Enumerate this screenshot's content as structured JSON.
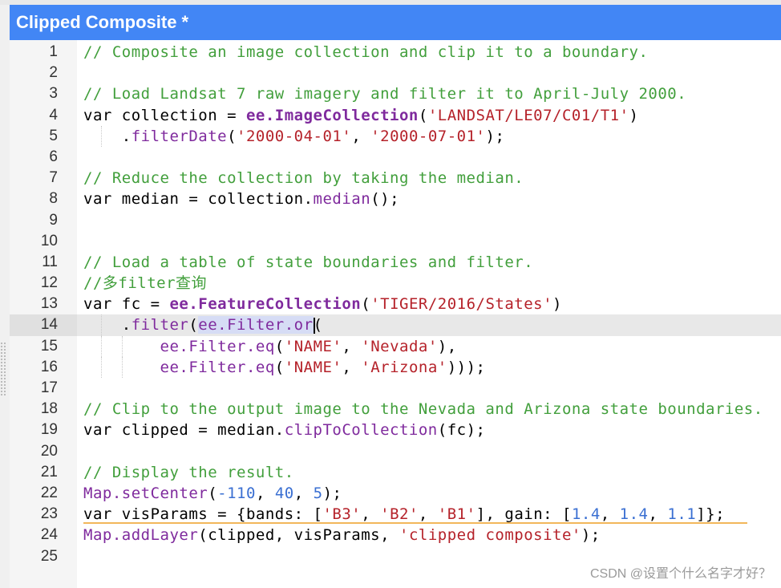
{
  "window": {
    "title": "Clipped Composite *"
  },
  "editor": {
    "active_line": 14,
    "lines": [
      {
        "num": "1",
        "tokens": [
          {
            "t": "c",
            "v": "// Composite an image collection and clip it to a boundary."
          }
        ]
      },
      {
        "num": "2",
        "tokens": []
      },
      {
        "num": "3",
        "tokens": [
          {
            "t": "c",
            "v": "// Load Landsat 7 raw imagery and filter it to April-July 2000."
          }
        ]
      },
      {
        "num": "4",
        "tokens": [
          {
            "t": "k",
            "v": "var collection = "
          },
          {
            "t": "ee",
            "v": "ee.ImageCollection"
          },
          {
            "t": "p",
            "v": "("
          },
          {
            "t": "s",
            "v": "'LANDSAT/LE07/C01/T1'"
          },
          {
            "t": "p",
            "v": ")"
          }
        ]
      },
      {
        "num": "5",
        "tokens": [
          {
            "t": "p",
            "v": "    ."
          },
          {
            "t": "m",
            "v": "filterDate"
          },
          {
            "t": "p",
            "v": "("
          },
          {
            "t": "s",
            "v": "'2000-04-01'"
          },
          {
            "t": "p",
            "v": ", "
          },
          {
            "t": "s",
            "v": "'2000-07-01'"
          },
          {
            "t": "p",
            "v": ");"
          }
        ]
      },
      {
        "num": "6",
        "tokens": []
      },
      {
        "num": "7",
        "tokens": [
          {
            "t": "c",
            "v": "// Reduce the collection by taking the median."
          }
        ]
      },
      {
        "num": "8",
        "tokens": [
          {
            "t": "k",
            "v": "var median = collection."
          },
          {
            "t": "m",
            "v": "median"
          },
          {
            "t": "p",
            "v": "();"
          }
        ]
      },
      {
        "num": "9",
        "tokens": []
      },
      {
        "num": "10",
        "tokens": []
      },
      {
        "num": "11",
        "tokens": [
          {
            "t": "c",
            "v": "// Load a table of state boundaries and filter."
          }
        ]
      },
      {
        "num": "12",
        "tokens": [
          {
            "t": "c",
            "v": "//多filter查询"
          }
        ]
      },
      {
        "num": "13",
        "tokens": [
          {
            "t": "k",
            "v": "var fc = "
          },
          {
            "t": "ee",
            "v": "ee.FeatureCollection"
          },
          {
            "t": "p",
            "v": "("
          },
          {
            "t": "s",
            "v": "'TIGER/2016/States'"
          },
          {
            "t": "p",
            "v": ")"
          }
        ]
      },
      {
        "num": "14",
        "tokens": [
          {
            "t": "p",
            "v": "    ."
          },
          {
            "t": "m",
            "v": "filter"
          },
          {
            "t": "p",
            "v": "("
          },
          {
            "t": "msel",
            "v": "ee.Filter.or"
          },
          {
            "t": "cursor",
            "v": ""
          },
          {
            "t": "p",
            "v": "("
          }
        ]
      },
      {
        "num": "15",
        "tokens": [
          {
            "t": "p",
            "v": "        "
          },
          {
            "t": "m",
            "v": "ee.Filter.eq"
          },
          {
            "t": "p",
            "v": "("
          },
          {
            "t": "s",
            "v": "'NAME'"
          },
          {
            "t": "p",
            "v": ", "
          },
          {
            "t": "s",
            "v": "'Nevada'"
          },
          {
            "t": "p",
            "v": "),"
          }
        ]
      },
      {
        "num": "16",
        "tokens": [
          {
            "t": "p",
            "v": "        "
          },
          {
            "t": "m",
            "v": "ee.Filter.eq"
          },
          {
            "t": "p",
            "v": "("
          },
          {
            "t": "s",
            "v": "'NAME'"
          },
          {
            "t": "p",
            "v": ", "
          },
          {
            "t": "s",
            "v": "'Arizona'"
          },
          {
            "t": "p",
            "v": ")));"
          }
        ]
      },
      {
        "num": "17",
        "tokens": []
      },
      {
        "num": "18",
        "tokens": [
          {
            "t": "c",
            "v": "// Clip to the output image to the Nevada and Arizona state boundaries."
          }
        ]
      },
      {
        "num": "19",
        "tokens": [
          {
            "t": "k",
            "v": "var clipped = median."
          },
          {
            "t": "m",
            "v": "clipToCollection"
          },
          {
            "t": "p",
            "v": "(fc);"
          }
        ]
      },
      {
        "num": "20",
        "tokens": []
      },
      {
        "num": "21",
        "tokens": [
          {
            "t": "c",
            "v": "// Display the result."
          }
        ]
      },
      {
        "num": "22",
        "tokens": [
          {
            "t": "m",
            "v": "Map.setCenter"
          },
          {
            "t": "p",
            "v": "("
          },
          {
            "t": "n",
            "v": "-110"
          },
          {
            "t": "p",
            "v": ", "
          },
          {
            "t": "n",
            "v": "40"
          },
          {
            "t": "p",
            "v": ", "
          },
          {
            "t": "n",
            "v": "5"
          },
          {
            "t": "p",
            "v": ");"
          }
        ]
      },
      {
        "num": "23",
        "tokens": [
          {
            "t": "k",
            "v": "var visParams = {bands: ["
          },
          {
            "t": "s",
            "v": "'B3'"
          },
          {
            "t": "p",
            "v": ", "
          },
          {
            "t": "s",
            "v": "'B2'"
          },
          {
            "t": "p",
            "v": ", "
          },
          {
            "t": "s",
            "v": "'B1'"
          },
          {
            "t": "p",
            "v": "], gain: ["
          },
          {
            "t": "n",
            "v": "1.4"
          },
          {
            "t": "p",
            "v": ", "
          },
          {
            "t": "n",
            "v": "1.4"
          },
          {
            "t": "p",
            "v": ", "
          },
          {
            "t": "n",
            "v": "1.1"
          },
          {
            "t": "p",
            "v": "]};"
          }
        ]
      },
      {
        "num": "24",
        "tokens": [
          {
            "t": "m",
            "v": "Map.addLayer"
          },
          {
            "t": "p",
            "v": "(clipped, visParams, "
          },
          {
            "t": "s",
            "v": "'clipped composite'"
          },
          {
            "t": "p",
            "v": ");"
          }
        ]
      },
      {
        "num": "25",
        "tokens": []
      }
    ]
  },
  "watermark": "CSDN @设置个什么名字才好？",
  "colors": {
    "header_bg": "#4286f5",
    "comment": "#429f3c",
    "string": "#b5222a",
    "method": "#7f2a9d",
    "number": "#3a6fd2"
  }
}
